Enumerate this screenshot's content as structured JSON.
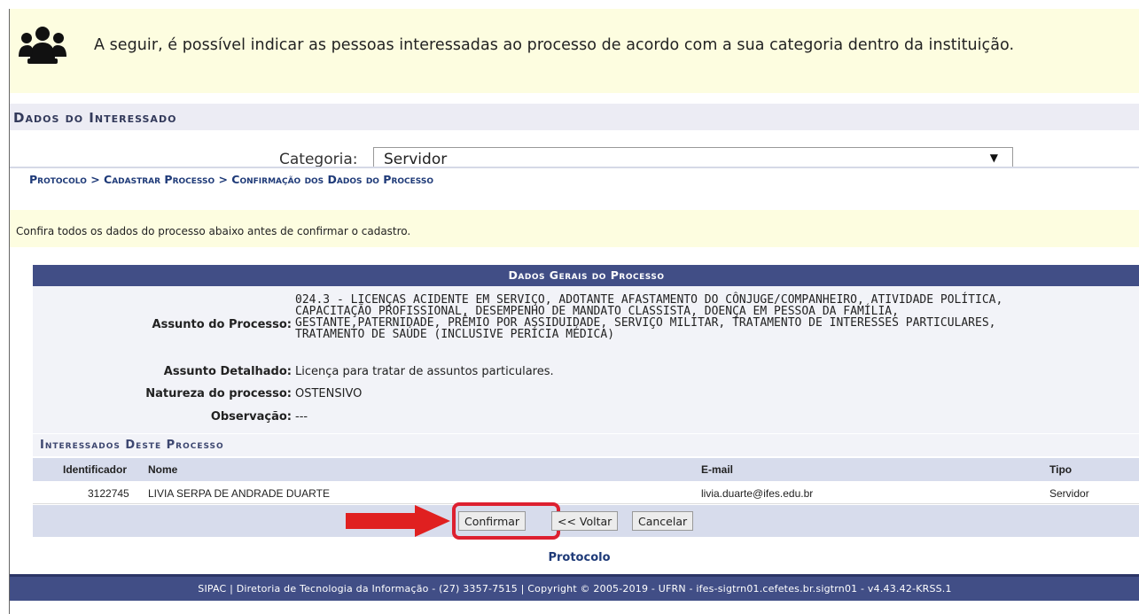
{
  "info": {
    "icon": "people-group-icon",
    "text": "A seguir, é possível indicar as pessoas interessadas ao processo de acordo com a sua categoria dentro da instituição."
  },
  "section": {
    "title": "Dados do Interessado"
  },
  "categoria": {
    "label": "Categoria:",
    "value": "Servidor"
  },
  "breadcrumb": "Protocolo > Cadastrar Processo > Confirmação dos Dados do Processo",
  "confira": "Confira todos os dados do processo abaixo antes de confirmar o cadastro.",
  "dados_gerais": {
    "title": "Dados Gerais do Processo",
    "assunto_label": "Assunto do Processo:",
    "assunto_value": "024.3 - LICENÇAS ACIDENTE EM SERVIÇO, ADOTANTE AFASTAMENTO DO CÔNJUGE/COMPANHEIRO, ATIVIDADE POLÍTICA,\nCAPACITAÇÃO PROFISSIONAL, DESEMPENHO DE MANDATO CLASSISTA, DOENÇA EM PESSOA DA FAMÍLIA,\nGESTANTE,PATERNIDADE, PRÊMIO POR ASSIDUIDADE, SERVIÇO MILITAR, TRATAMENTO DE INTERESSES PARTICULARES,\nTRATAMENTO DE SAÚDE (INCLUSIVE PERÍCIA MÉDICA)",
    "detalhado_label": "Assunto Detalhado:",
    "detalhado_value": "Licença para tratar de assuntos particulares.",
    "natureza_label": "Natureza do processo:",
    "natureza_value": "OSTENSIVO",
    "observacao_label": "Observação:",
    "observacao_value": "---"
  },
  "interessados": {
    "title": "Interessados Deste Processo",
    "columns": [
      "Identificador",
      "Nome",
      "E-mail",
      "Tipo"
    ],
    "rows": [
      [
        "3122745",
        "LIVIA SERPA DE ANDRADE DUARTE",
        "livia.duarte@ifes.edu.br",
        "Servidor"
      ]
    ]
  },
  "buttons": {
    "confirmar": "Confirmar",
    "voltar": "<< Voltar",
    "cancelar": "Cancelar"
  },
  "highlight_color": "#dd2030",
  "link": "Protocolo",
  "footer": "SIPAC | Diretoria de Tecnologia da Informação - (27) 3357-7515 | Copyright © 2005-2019 - UFRN - ifes-sigtrn01.cefetes.br.sigtrn01 - v4.43.42-KRSS.1"
}
